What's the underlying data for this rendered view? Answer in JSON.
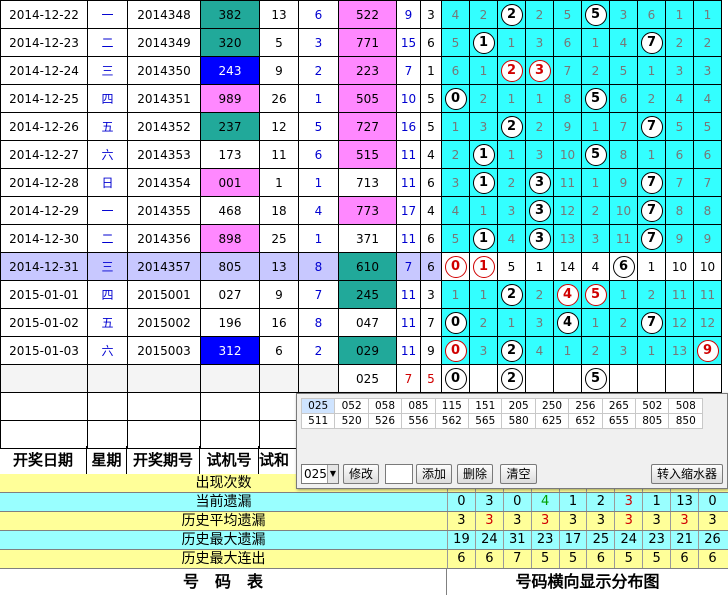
{
  "rows": [
    {
      "date": "2014-12-22",
      "week": "一",
      "issue": "2014348",
      "test": "382",
      "testbg": "teal",
      "a": "13",
      "b": "6",
      "win": "522",
      "winbg": "pink",
      "s": "9",
      "t": "3",
      "dist": [
        "4",
        "2",
        "2",
        "2",
        "5",
        "5",
        "3",
        "6",
        "1",
        "1"
      ],
      "balls": [
        2,
        5
      ],
      "red": []
    },
    {
      "date": "2014-12-23",
      "week": "二",
      "issue": "2014349",
      "test": "320",
      "testbg": "teal",
      "a": "5",
      "b": "3",
      "win": "771",
      "winbg": "pink",
      "s": "15",
      "t": "6",
      "dist": [
        "5",
        "1",
        "1",
        "3",
        "6",
        "1",
        "4",
        "7",
        "2",
        "2"
      ],
      "balls": [
        1,
        7
      ],
      "red": []
    },
    {
      "date": "2014-12-24",
      "week": "三",
      "issue": "2014350",
      "test": "243",
      "testbg": "blue",
      "a": "9",
      "b": "2",
      "win": "223",
      "winbg": "pink",
      "s": "7",
      "t": "1",
      "dist": [
        "6",
        "1",
        "2",
        "3",
        "7",
        "2",
        "5",
        "1",
        "3",
        "3"
      ],
      "balls": [
        2,
        3
      ],
      "red": [
        2,
        3
      ]
    },
    {
      "date": "2014-12-25",
      "week": "四",
      "issue": "2014351",
      "test": "989",
      "testbg": "pink",
      "a": "26",
      "b": "1",
      "win": "505",
      "winbg": "pink",
      "s": "10",
      "t": "5",
      "dist": [
        "0",
        "2",
        "1",
        "1",
        "8",
        "5",
        "6",
        "2",
        "4",
        "4"
      ],
      "balls": [
        0,
        5
      ],
      "red": []
    },
    {
      "date": "2014-12-26",
      "week": "五",
      "issue": "2014352",
      "test": "237",
      "testbg": "teal",
      "a": "12",
      "b": "5",
      "win": "727",
      "winbg": "pink",
      "s": "16",
      "t": "5",
      "dist": [
        "1",
        "3",
        "2",
        "2",
        "9",
        "1",
        "7",
        "7",
        "5",
        "5"
      ],
      "balls": [
        2,
        7
      ],
      "red": []
    },
    {
      "date": "2014-12-27",
      "week": "六",
      "issue": "2014353",
      "test": "173",
      "testbg": "",
      "a": "11",
      "b": "6",
      "win": "515",
      "winbg": "pink",
      "s": "11",
      "t": "4",
      "dist": [
        "2",
        "1",
        "1",
        "3",
        "10",
        "5",
        "8",
        "1",
        "6",
        "6"
      ],
      "balls": [
        1,
        5
      ],
      "red": []
    },
    {
      "date": "2014-12-28",
      "week": "日",
      "issue": "2014354",
      "test": "001",
      "testbg": "pink",
      "a": "1",
      "b": "1",
      "win": "713",
      "winbg": "",
      "s": "11",
      "t": "6",
      "dist": [
        "3",
        "1",
        "2",
        "3",
        "11",
        "1",
        "9",
        "7",
        "7",
        "7"
      ],
      "balls": [
        1,
        3,
        7
      ],
      "red": []
    },
    {
      "date": "2014-12-29",
      "week": "一",
      "issue": "2014355",
      "test": "468",
      "testbg": "",
      "a": "18",
      "b": "4",
      "win": "773",
      "winbg": "pink",
      "s": "17",
      "t": "4",
      "dist": [
        "4",
        "1",
        "3",
        "3",
        "12",
        "2",
        "10",
        "7",
        "8",
        "8"
      ],
      "balls": [
        3,
        7
      ],
      "red": []
    },
    {
      "date": "2014-12-30",
      "week": "二",
      "issue": "2014356",
      "test": "898",
      "testbg": "pink",
      "a": "25",
      "b": "1",
      "win": "371",
      "winbg": "",
      "s": "11",
      "t": "6",
      "dist": [
        "5",
        "1",
        "4",
        "3",
        "13",
        "3",
        "11",
        "7",
        "9",
        "9"
      ],
      "balls": [
        1,
        3,
        7
      ],
      "red": []
    },
    {
      "date": "2014-12-31",
      "week": "三",
      "issue": "2014357",
      "test": "805",
      "testbg": "",
      "a": "13",
      "b": "8",
      "win": "610",
      "winbg": "hlteal",
      "s": "7",
      "t": "6",
      "dist": [
        "0",
        "1",
        "5",
        "1",
        "14",
        "4",
        "6",
        "1",
        "10",
        "10"
      ],
      "balls": [
        0,
        1,
        6
      ],
      "red": [
        0,
        1
      ],
      "hl": true
    },
    {
      "date": "2015-01-01",
      "week": "四",
      "issue": "2015001",
      "test": "027",
      "testbg": "",
      "a": "9",
      "b": "7",
      "win": "245",
      "winbg": "teal",
      "s": "11",
      "t": "3",
      "dist": [
        "1",
        "1",
        "2",
        "2",
        "4",
        "5",
        "1",
        "2",
        "11",
        "11"
      ],
      "balls": [
        2,
        4,
        5
      ],
      "red": [
        4,
        5
      ]
    },
    {
      "date": "2015-01-02",
      "week": "五",
      "issue": "2015002",
      "test": "196",
      "testbg": "",
      "a": "16",
      "b": "8",
      "win": "047",
      "winbg": "",
      "s": "11",
      "t": "7",
      "dist": [
        "0",
        "2",
        "1",
        "3",
        "4",
        "1",
        "2",
        "7",
        "12",
        "12"
      ],
      "balls": [
        0,
        4,
        7
      ],
      "red": []
    },
    {
      "date": "2015-01-03",
      "week": "六",
      "issue": "2015003",
      "test": "312",
      "testbg": "blue",
      "a": "6",
      "b": "2",
      "win": "029",
      "winbg": "teal",
      "s": "11",
      "t": "9",
      "dist": [
        "0",
        "3",
        "2",
        "4",
        "1",
        "2",
        "3",
        "1",
        "13",
        "9"
      ],
      "balls": [
        0,
        2,
        9
      ],
      "red": [
        0,
        9
      ]
    }
  ],
  "pending": {
    "win": "025",
    "s": "7",
    "t": "5",
    "balls": [
      0,
      2,
      5
    ]
  },
  "header": {
    "date": "开奖日期",
    "week": "星期",
    "issue": "开奖期号",
    "test": "试机号",
    "a": "试和"
  },
  "stats": [
    {
      "label": "出现次数",
      "bg": "y",
      "vals": []
    },
    {
      "label": "当前遗漏",
      "bg": "c",
      "vals": [
        "0",
        "3",
        "0",
        "4",
        "1",
        "2",
        "3",
        "1",
        "13",
        "0"
      ],
      "colors": [
        "",
        "",
        "",
        "g",
        "",
        "",
        "r",
        "",
        "",
        ""
      ]
    },
    {
      "label": "历史平均遗漏",
      "bg": "y",
      "vals": [
        "3",
        "3",
        "3",
        "3",
        "3",
        "3",
        "3",
        "3",
        "3",
        "3"
      ],
      "colors": [
        "",
        "r",
        "",
        "r",
        "",
        "",
        "r",
        "",
        "r",
        ""
      ]
    },
    {
      "label": "历史最大遗漏",
      "bg": "c",
      "vals": [
        "19",
        "24",
        "31",
        "23",
        "17",
        "25",
        "24",
        "23",
        "21",
        "26"
      ],
      "colors": []
    },
    {
      "label": "历史最大连出",
      "bg": "y",
      "vals": [
        "6",
        "6",
        "7",
        "5",
        "5",
        "6",
        "5",
        "5",
        "6",
        "6"
      ],
      "colors": []
    }
  ],
  "footer": {
    "left": "号　码　表",
    "right": "号码横向显示分布图"
  },
  "popup": {
    "numbers": [
      [
        "025",
        "052",
        "058",
        "085",
        "115",
        "151",
        "205",
        "250",
        "256",
        "265",
        "502",
        "508"
      ],
      [
        "511",
        "520",
        "526",
        "556",
        "562",
        "565",
        "580",
        "625",
        "652",
        "655",
        "805",
        "850"
      ]
    ],
    "combo": "025",
    "combo_arrow": "▼",
    "modify": "修改",
    "input": "",
    "add": "添加",
    "delete": "删除",
    "clear": "清空",
    "transfer": "转入缩水器"
  },
  "colors": {
    "teal": "#21a99a",
    "blue": "#0000ff",
    "pink": "#ff88ff",
    "cyan": "#33ffff",
    "hl": "#c8c8ff",
    "red": "#d00000"
  }
}
